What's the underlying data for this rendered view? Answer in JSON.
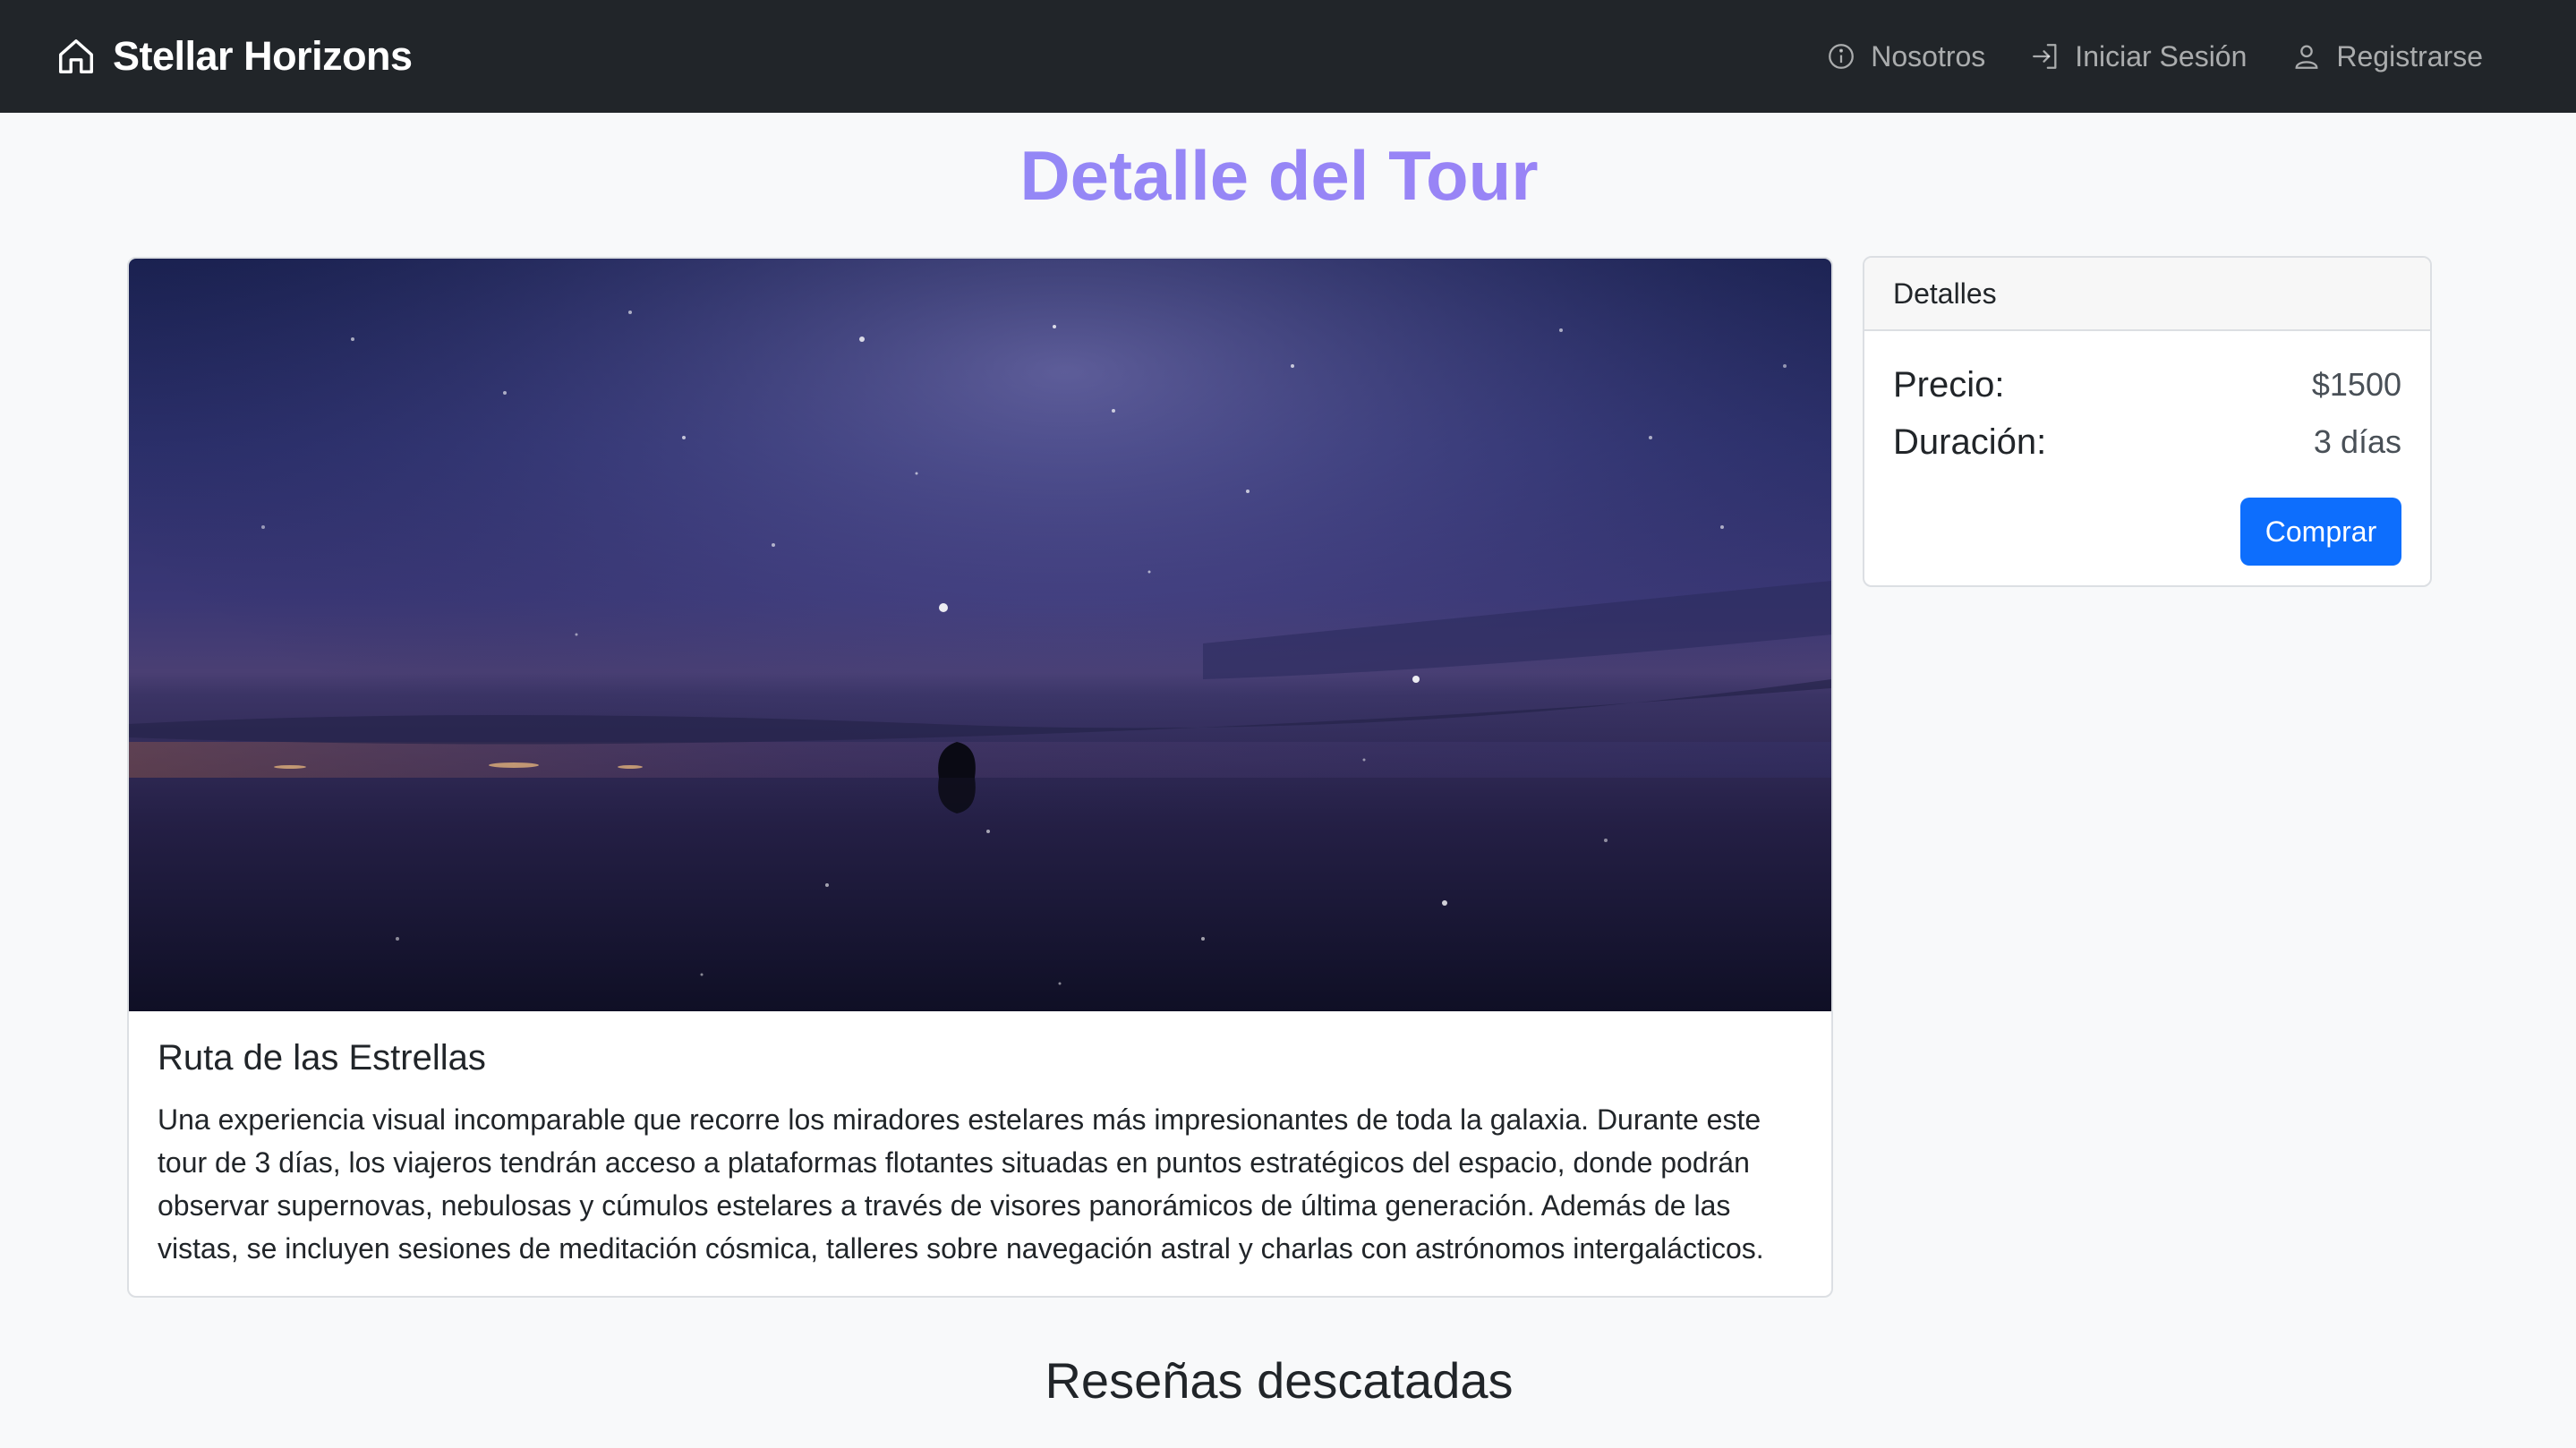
{
  "navbar": {
    "brand": "Stellar Horizons",
    "brand_icon": "home-icon",
    "links": [
      {
        "label": "Nosotros",
        "icon": "info-circle-icon"
      },
      {
        "label": "Iniciar Sesión",
        "icon": "login-arrow-icon"
      },
      {
        "label": "Registrarse",
        "icon": "person-icon"
      }
    ]
  },
  "page": {
    "title": "Detalle del Tour"
  },
  "tour": {
    "title": "Ruta de las Estrellas",
    "description": "Una experiencia visual incomparable que recorre los miradores estelares más impresionantes de toda la galaxia. Durante este tour de 3 días, los viajeros tendrán acceso a plataformas flotantes situadas en puntos estratégicos del espacio, donde podrán observar supernovas, nebulosas y cúmulos estelares a través de visores panorámicos de última generación. Además de las vistas, se incluyen sesiones de meditación cósmica, talleres sobre navegación astral y charlas con astrónomos intergalácticos."
  },
  "details": {
    "header": "Detalles",
    "price_label": "Precio:",
    "price_value": "$1500",
    "duration_label": "Duración:",
    "duration_value": "3 días",
    "buy_label": "Comprar"
  },
  "reviews": {
    "title": "Reseñas descatadas"
  },
  "colors": {
    "navbar_bg": "#212529",
    "title_gradient_start": "#8b8ff7",
    "title_gradient_end": "#a27cf5",
    "primary_button": "#0d6efd",
    "page_bg": "#f8f9fa"
  }
}
